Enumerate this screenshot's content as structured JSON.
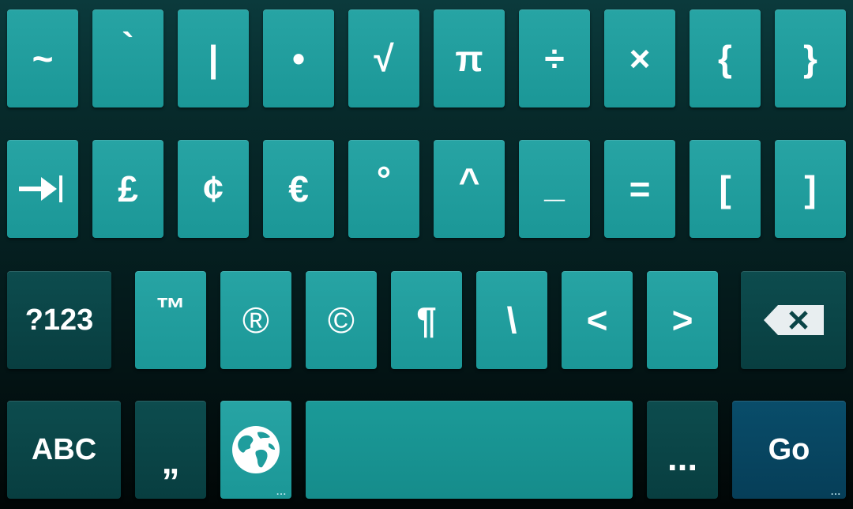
{
  "keyboard": {
    "row1": [
      "~",
      "`",
      "|",
      "•",
      "√",
      "π",
      "÷",
      "×",
      "{",
      "}"
    ],
    "row2": [
      "£",
      "¢",
      "€",
      "°",
      "^",
      "_",
      "=",
      "[",
      "]"
    ],
    "row3": [
      "?123",
      "™",
      "®",
      "©",
      "¶",
      "\\",
      "<",
      ">"
    ],
    "row4": {
      "abc": "ABC",
      "comma": "„",
      "ellipsis": "...",
      "go": "Go",
      "more_indicator": "..."
    }
  },
  "icons": {
    "tab": "tab-icon",
    "backspace": "backspace-icon",
    "globe": "globe-icon"
  },
  "colors": {
    "key": "#1f9d9d",
    "dark_key": "#0a4446",
    "go_key": "#07465f",
    "text": "#ffffff"
  }
}
